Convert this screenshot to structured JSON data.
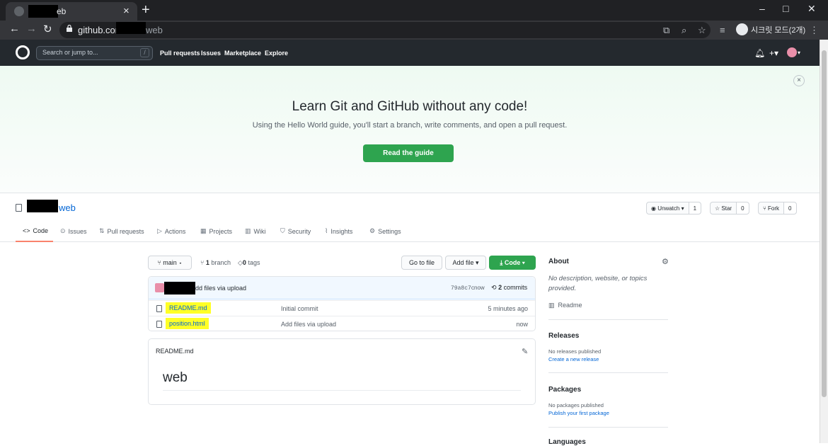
{
  "browser": {
    "tab_title": "eb",
    "tab_close": "×",
    "new_tab": "+",
    "url_host": "github.com",
    "url_path": "web",
    "incognito_label": "시크릿 모드(2개)",
    "window_controls": [
      "–",
      "□",
      "✕"
    ]
  },
  "gh_header": {
    "search_placeholder": "Search or jump to...",
    "search_shortcut": "/",
    "nav": [
      "Pull requests",
      "Issues",
      "Marketplace",
      "Explore"
    ]
  },
  "banner": {
    "heading": "Learn Git and GitHub without any code!",
    "subtitle": "Using the Hello World guide, you'll start a branch, write comments, and open a pull request.",
    "button": "Read the guide",
    "close": "×"
  },
  "repo": {
    "name": "web",
    "watch_label": "Unwatch ▾",
    "watch_count": "1",
    "star_label": "Star",
    "star_count": "0",
    "fork_label": "Fork",
    "fork_count": "0"
  },
  "tabs": [
    {
      "label": "Code",
      "icon": "code-icon"
    },
    {
      "label": "Issues",
      "icon": "issue-icon"
    },
    {
      "label": "Pull requests",
      "icon": "pull-request-icon"
    },
    {
      "label": "Actions",
      "icon": "actions-icon"
    },
    {
      "label": "Projects",
      "icon": "projects-icon"
    },
    {
      "label": "Wiki",
      "icon": "wiki-icon"
    },
    {
      "label": "Security",
      "icon": "shield-icon"
    },
    {
      "label": "Insights",
      "icon": "graph-icon"
    },
    {
      "label": "Settings",
      "icon": "gear-icon"
    }
  ],
  "toolbar": {
    "branch": "main",
    "branch_count": "1",
    "branch_label": "branch",
    "tag_count": "0",
    "tag_label": "tags",
    "go_to_file": "Go to file",
    "add_file": "Add file ▾",
    "code": "Code"
  },
  "latest_commit": {
    "message": "dd files via upload",
    "sha": "79a8c7c",
    "age": "now",
    "commit_count": "2",
    "commit_label": "commits"
  },
  "files": [
    {
      "name": "README.md",
      "message": "Initial commit",
      "age": "5 minutes ago"
    },
    {
      "name": "position.html",
      "message": "Add files via upload",
      "age": "now"
    }
  ],
  "readme": {
    "filename": "README.md",
    "title": "web"
  },
  "sidebar": {
    "about_heading": "About",
    "about_desc": "No description, website, or topics provided.",
    "readme_link": "Readme",
    "releases_heading": "Releases",
    "releases_text": "No releases published",
    "releases_link": "Create a new release",
    "packages_heading": "Packages",
    "packages_text": "No packages published",
    "packages_link": "Publish your first package",
    "languages_heading": "Languages"
  },
  "colors": {
    "green": "#2ea44f",
    "link": "#0366d6",
    "header_bg": "#24292e",
    "highlight": "#ffff26"
  }
}
